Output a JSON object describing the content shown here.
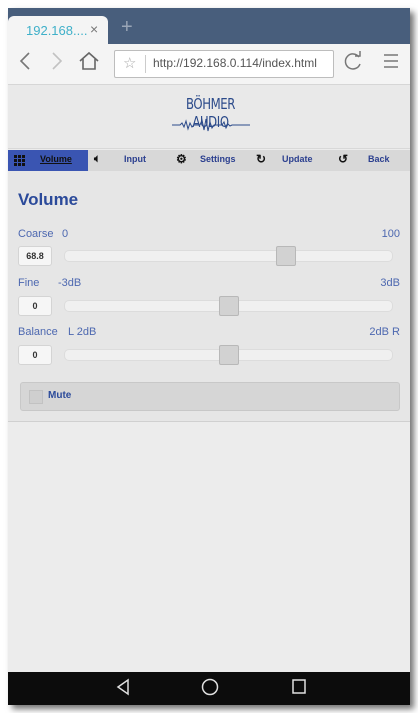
{
  "browser": {
    "tab_title": "192.168....",
    "tab_close": "×",
    "new_tab": "+",
    "url": "http://192.168.0.114/index.html",
    "icons": [
      "back-icon",
      "forward-icon",
      "home-icon",
      "star-icon",
      "reload-icon",
      "menu-icon"
    ]
  },
  "header": {
    "logo_text": "BÖHMER AUDIO"
  },
  "nav": {
    "volume": "Volume",
    "input": "Input",
    "settings": "Settings",
    "update": "Update",
    "back": "Back"
  },
  "volume": {
    "title": "Volume",
    "coarse": {
      "label": "Coarse",
      "min": "0",
      "max": "100",
      "value": "68.8",
      "level_fraction": 0.688
    },
    "fine": {
      "label": "Fine",
      "min": "-3dB",
      "max": "3dB",
      "value": "0",
      "level_fraction": 0.5
    },
    "balance": {
      "label": "Balance",
      "min": "L 2dB",
      "max": "2dB R",
      "value": "0",
      "level_fraction": 0.5
    },
    "mute_label": "Mute",
    "mute_checked": false
  },
  "colors": {
    "accent": "#2b4a9a",
    "nav_active": "#3a55b2",
    "tab_text": "#3fb0c9"
  }
}
